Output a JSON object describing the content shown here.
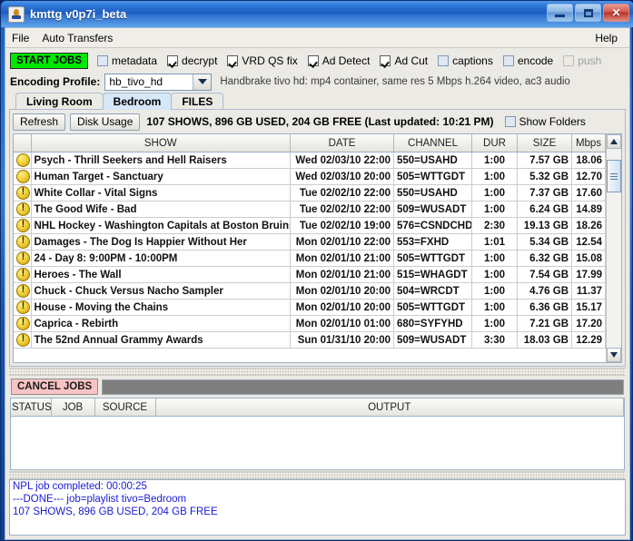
{
  "window": {
    "title": "kmttg v0p7i_beta",
    "icon": "java-coffee-cup-icon",
    "minimize_label": "–",
    "maximize_label": "□",
    "close_label": "✕"
  },
  "menubar": {
    "items": [
      {
        "label": "File",
        "name": "menu-file"
      },
      {
        "label": "Auto Transfers",
        "name": "menu-auto-transfers"
      }
    ],
    "help": "Help"
  },
  "toolbar": {
    "start_jobs_label": "START JOBS",
    "start_jobs_color": "#00e800",
    "options": [
      {
        "label": "metadata",
        "checked": false,
        "disabled": false
      },
      {
        "label": "decrypt",
        "checked": true,
        "disabled": false
      },
      {
        "label": "VRD QS fix",
        "checked": true,
        "disabled": false
      },
      {
        "label": "Ad Detect",
        "checked": true,
        "disabled": false
      },
      {
        "label": "Ad Cut",
        "checked": true,
        "disabled": false
      },
      {
        "label": "captions",
        "checked": false,
        "disabled": false
      },
      {
        "label": "encode",
        "checked": false,
        "disabled": false
      },
      {
        "label": "push",
        "checked": false,
        "disabled": true
      }
    ],
    "encoding_profile_label": "Encoding Profile:",
    "encoding_profile_value": "hb_tivo_hd",
    "encoding_profile_description": "Handbrake tivo hd: mp4 container, same res 5 Mbps h.264 video, ac3 audio"
  },
  "tabs": [
    {
      "label": "Living Room",
      "active": false
    },
    {
      "label": "Bedroom",
      "active": true
    },
    {
      "label": "FILES",
      "active": false
    }
  ],
  "npl": {
    "refresh_label": "Refresh",
    "disk_usage_label": "Disk Usage",
    "status": "107 SHOWS, 896 GB USED, 204 GB FREE (Last updated: 10:21 PM)",
    "show_folders_label": "Show Folders",
    "show_folders_checked": false,
    "columns": [
      "",
      "SHOW",
      "DATE",
      "CHANNEL",
      "DUR",
      "SIZE",
      "Mbps"
    ],
    "rows": [
      {
        "icon": "circle",
        "show": "Psych - Thrill Seekers and Hell Raisers",
        "date": "Wed 02/03/10 22:00",
        "channel": "550=USAHD",
        "dur": "1:00",
        "size": "7.57 GB",
        "mbps": "18.06"
      },
      {
        "icon": "circle",
        "show": "Human Target - Sanctuary",
        "date": "Wed 02/03/10 20:00",
        "channel": "505=WTTGDT",
        "dur": "1:00",
        "size": "5.32 GB",
        "mbps": "12.70"
      },
      {
        "icon": "circle-bang",
        "show": "White Collar - Vital Signs",
        "date": "Tue 02/02/10 22:00",
        "channel": "550=USAHD",
        "dur": "1:00",
        "size": "7.37 GB",
        "mbps": "17.60"
      },
      {
        "icon": "circle-bang",
        "show": "The Good Wife - Bad",
        "date": "Tue 02/02/10 22:00",
        "channel": "509=WUSADT",
        "dur": "1:00",
        "size": "6.24 GB",
        "mbps": "14.89"
      },
      {
        "icon": "circle-bang",
        "show": "NHL Hockey - Washington Capitals at Boston Bruins",
        "date": "Tue 02/02/10 19:00",
        "channel": "576=CSNDCHD",
        "dur": "2:30",
        "size": "19.13 GB",
        "mbps": "18.26"
      },
      {
        "icon": "circle-bang",
        "show": "Damages - The Dog Is Happier Without Her",
        "date": "Mon 02/01/10 22:00",
        "channel": "553=FXHD",
        "dur": "1:01",
        "size": "5.34 GB",
        "mbps": "12.54"
      },
      {
        "icon": "circle-bang",
        "show": "24 - Day 8: 9:00PM - 10:00PM",
        "date": "Mon 02/01/10 21:00",
        "channel": "505=WTTGDT",
        "dur": "1:00",
        "size": "6.32 GB",
        "mbps": "15.08"
      },
      {
        "icon": "circle-bang",
        "show": "Heroes - The Wall",
        "date": "Mon 02/01/10 21:00",
        "channel": "515=WHAGDT",
        "dur": "1:00",
        "size": "7.54 GB",
        "mbps": "17.99"
      },
      {
        "icon": "circle-bang",
        "show": "Chuck - Chuck Versus Nacho Sampler",
        "date": "Mon 02/01/10 20:00",
        "channel": "504=WRCDT",
        "dur": "1:00",
        "size": "4.76 GB",
        "mbps": "11.37"
      },
      {
        "icon": "circle-bang",
        "show": "House - Moving the Chains",
        "date": "Mon 02/01/10 20:00",
        "channel": "505=WTTGDT",
        "dur": "1:00",
        "size": "6.36 GB",
        "mbps": "15.17"
      },
      {
        "icon": "circle-bang",
        "show": "Caprica - Rebirth",
        "date": "Mon 02/01/10 01:00",
        "channel": "680=SYFYHD",
        "dur": "1:00",
        "size": "7.21 GB",
        "mbps": "17.20"
      },
      {
        "icon": "circle-bang",
        "show": "The 52nd Annual Grammy Awards",
        "date": "Sun 01/31/10 20:00",
        "channel": "509=WUSADT",
        "dur": "3:30",
        "size": "18.03 GB",
        "mbps": "12.29"
      }
    ]
  },
  "jobs": {
    "cancel_label": "CANCEL JOBS",
    "cancel_color": "#f8c3c3",
    "progress_value": "",
    "columns": [
      "STATUS",
      "JOB",
      "SOURCE",
      "OUTPUT"
    ],
    "rows": []
  },
  "log": {
    "lines": [
      "NPL job completed: 00:00:25",
      "---DONE--- job=playlist tivo=Bedroom",
      "107 SHOWS, 896 GB USED, 204 GB FREE"
    ],
    "color": "#1a1ad6"
  }
}
